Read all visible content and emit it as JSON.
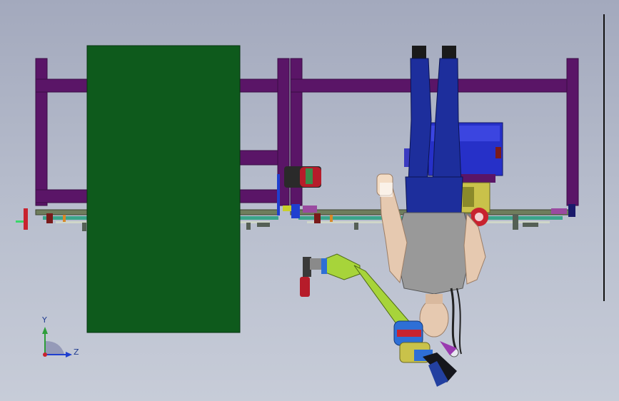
{
  "viewport": {
    "background_top": "#a3a9bd",
    "background_bottom": "#c7ccd8"
  },
  "triad": {
    "y_label": "Y",
    "z_label": "Z",
    "y_color": "#2e9e3a",
    "z_color": "#1f3fcf",
    "origin_color": "#c8232f"
  },
  "colors": {
    "frame": "#5a1567",
    "panel": "#0e5a1c",
    "rail": "#6f7d5d",
    "figure_clothing": "#1d2e9c",
    "figure_shirt": "#9a9a9a",
    "figure_skin": "#e6c9b0",
    "robot_arm": "#a7d43a",
    "robot_joint": "#2e6fd6",
    "accent_red": "#c8232f"
  }
}
